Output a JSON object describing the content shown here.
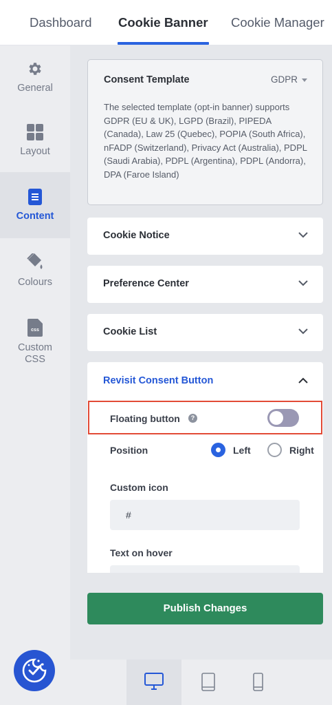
{
  "tabs": [
    {
      "label": "Dashboard"
    },
    {
      "label": "Cookie Banner"
    },
    {
      "label": "Cookie Manager"
    }
  ],
  "sidebar": {
    "items": [
      {
        "label": "General",
        "icon": "gear-icon"
      },
      {
        "label": "Layout",
        "icon": "grid-icon"
      },
      {
        "label": "Content",
        "icon": "document-icon"
      },
      {
        "label": "Colours",
        "icon": "paint-bucket-icon"
      },
      {
        "label_line1": "Custom",
        "label_line2": "CSS",
        "icon": "css-file-icon",
        "icon_text": "css"
      }
    ],
    "active": "Content"
  },
  "template": {
    "title": "Consent Template",
    "selected": "GDPR",
    "description": "The selected template (opt-in banner) supports GDPR (EU & UK), LGPD (Brazil), PIPEDA (Canada), Law 25 (Quebec), POPIA (South Africa), nFADP (Switzerland), Privacy Act (Australia), PDPL (Saudi Arabia), PDPL (Argentina), PDPL (Andorra), DPA (Faroe Island)"
  },
  "accordions": [
    {
      "title": "Cookie Notice",
      "expanded": false
    },
    {
      "title": "Preference Center",
      "expanded": false
    },
    {
      "title": "Cookie List",
      "expanded": false
    }
  ],
  "revisit": {
    "title": "Revisit Consent Button",
    "expanded": true,
    "floating_button_label": "Floating button",
    "floating_button_help": "?",
    "floating_button_enabled": false,
    "position_label": "Position",
    "position_options": [
      "Left",
      "Right"
    ],
    "position_selected": "Left",
    "custom_icon_label": "Custom icon",
    "custom_icon_value": "#",
    "text_on_hover_label": "Text on hover",
    "text_on_hover_value": ""
  },
  "publish_label": "Publish Changes",
  "devices": [
    {
      "icon": "desktop-icon",
      "active": true
    },
    {
      "icon": "tablet-icon",
      "active": false
    },
    {
      "icon": "mobile-icon",
      "active": false
    }
  ],
  "colors": {
    "accent": "#2a63e0",
    "publish": "#2e8a5c",
    "highlight": "#e24a36",
    "toggle_off": "#9a98b4"
  }
}
